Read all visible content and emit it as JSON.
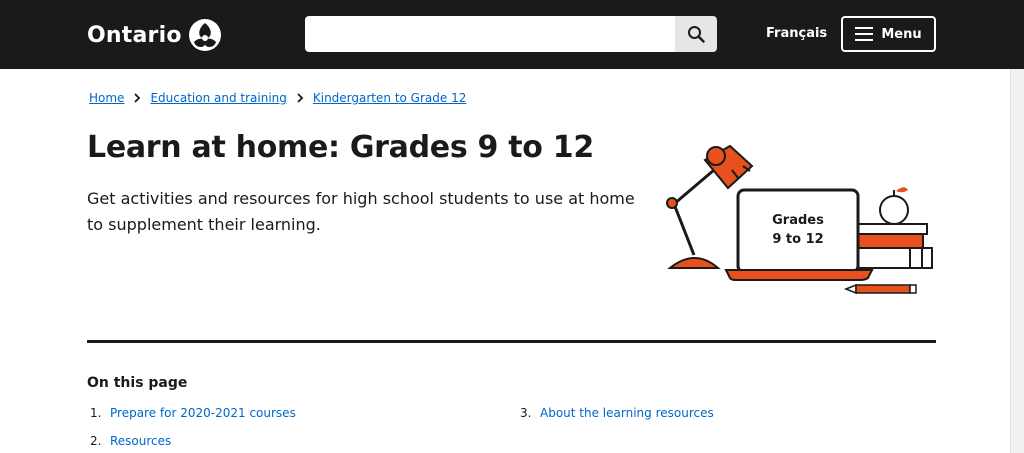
{
  "header": {
    "logo_text": "Ontario",
    "search": {
      "value": "",
      "placeholder": ""
    },
    "language_link": "Français",
    "menu_label": "Menu"
  },
  "breadcrumb": [
    {
      "label": "Home"
    },
    {
      "label": "Education and training"
    },
    {
      "label": "Kindergarten to Grade 12"
    }
  ],
  "page": {
    "title": "Learn at home: Grades 9 to 12",
    "lead": "Get activities and resources for high school students to use at home to supplement their learning.",
    "illustration": {
      "screen_line1": "Grades",
      "screen_line2": "9 to 12"
    }
  },
  "on_this_page": {
    "heading": "On this page",
    "items": [
      {
        "num": "1.",
        "label": "Prepare for 2020-2021 courses"
      },
      {
        "num": "2.",
        "label": "Resources"
      },
      {
        "num": "3.",
        "label": "About the learning resources"
      }
    ]
  },
  "colors": {
    "header_bg": "#1a1a1a",
    "link": "#0066cc",
    "accent_orange": "#e8501e"
  }
}
